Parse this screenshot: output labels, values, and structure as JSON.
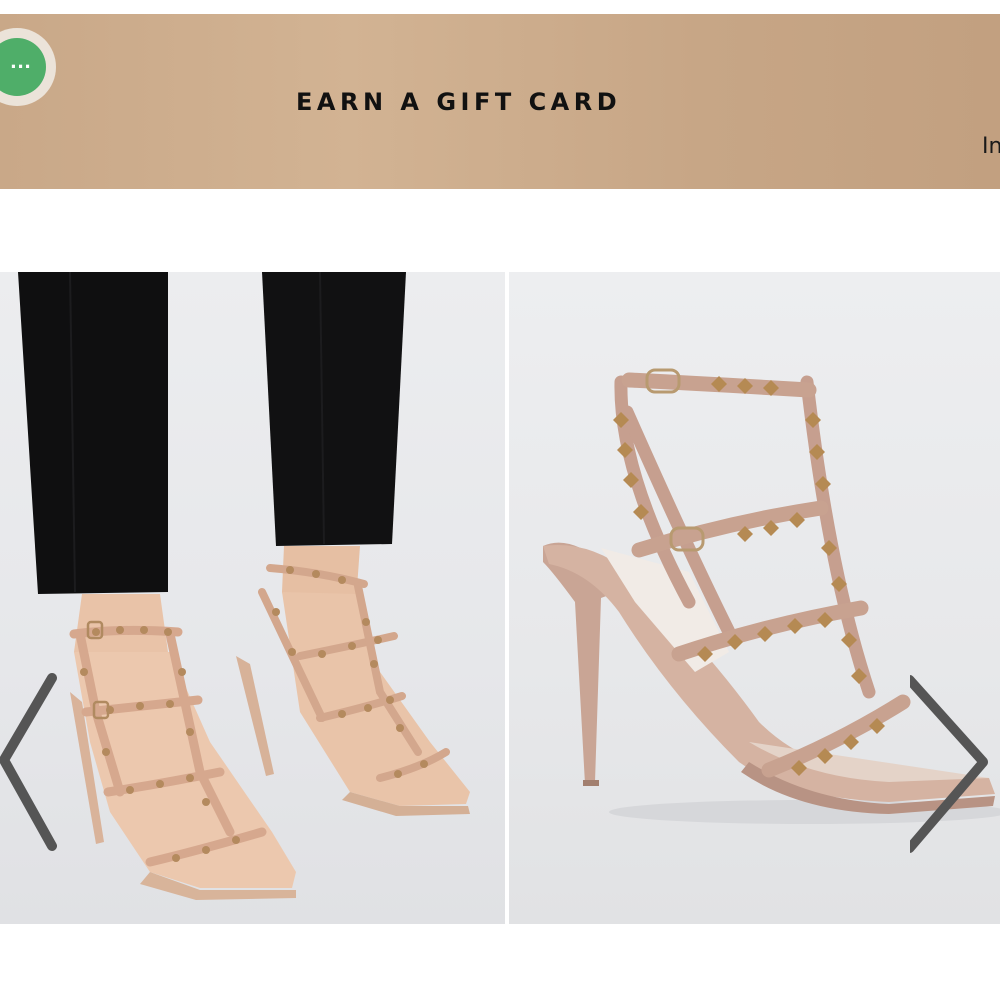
{
  "promo_banner": {
    "title": "EARN A GIFT CARD",
    "cutoff_text": "In"
  },
  "more_button": {
    "label": "...",
    "color": "#4fae69",
    "icon": "ellipsis-icon"
  },
  "gallery": {
    "slides": [
      {
        "subject": "studded-strappy-heel-sandals-on-model"
      },
      {
        "subject": "studded-strappy-heel-sandal-product-shot"
      }
    ],
    "prev_icon": "chevron-left-icon",
    "next_icon": "chevron-right-icon",
    "arrow_color": "#555555"
  }
}
